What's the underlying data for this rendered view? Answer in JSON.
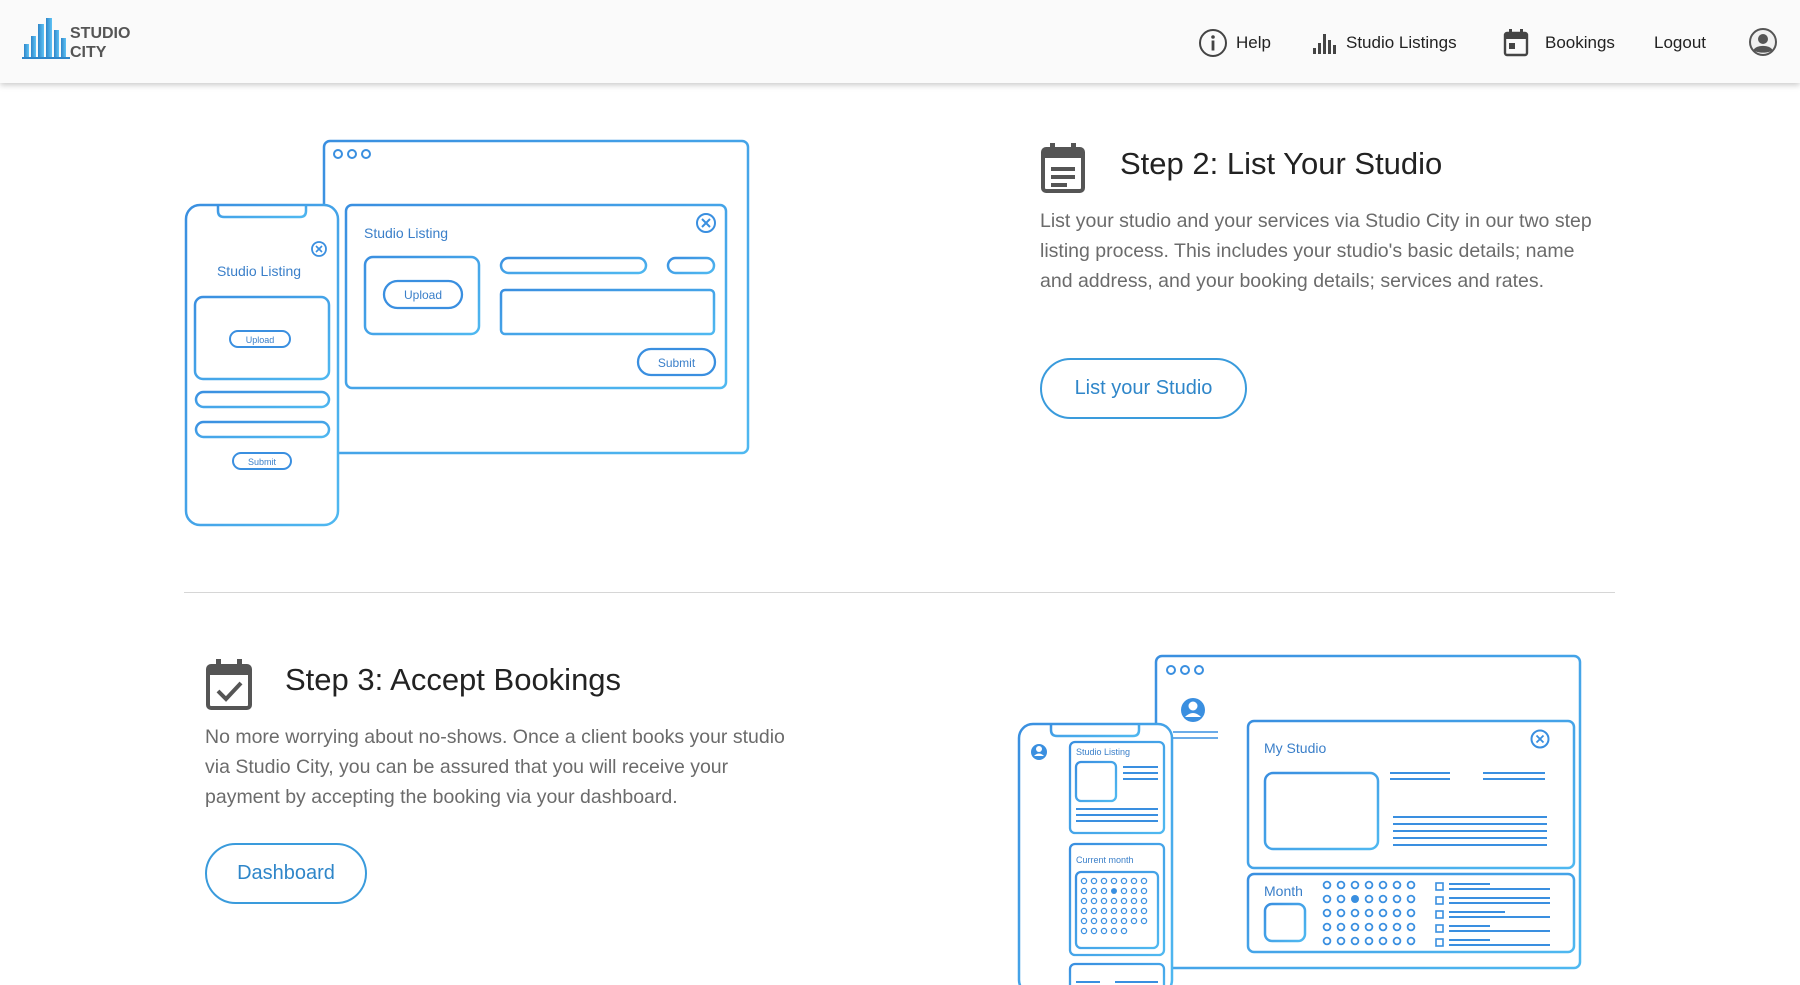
{
  "nav": {
    "brand": "STUDIO CITY",
    "help_label": "Help",
    "listings_label": "Studio Listings",
    "bookings_label": "Bookings",
    "logout_label": "Logout"
  },
  "step2": {
    "title": "Step 2: List Your Studio",
    "body": "List your studio and your services via Studio City in our two step listing process. This includes your studio's basic details; name and address, and your booking details; services and rates.",
    "button": "List your Studio",
    "illustration": {
      "window_heading": "Studio Listing",
      "window_upload": "Upload",
      "window_submit": "Submit",
      "phone_heading": "Studio Listing",
      "phone_upload": "Upload",
      "phone_submit": "Submit"
    }
  },
  "step3": {
    "title": "Step 3: Accept Bookings",
    "body": "No more worrying about no-shows. Once a client books your studio via Studio City, you can be assured that you will receive your payment by accepting the booking via your dashboard.",
    "button": "Dashboard",
    "illustration": {
      "main_heading": "My Studio",
      "month_label": "Month",
      "phone_heading": "Studio Listing",
      "phone_calendar_label": "Current month"
    }
  },
  "colors": {
    "accent": "#3a9bdc",
    "accent_dark": "#2f86c9",
    "icon_gray": "#555555"
  }
}
